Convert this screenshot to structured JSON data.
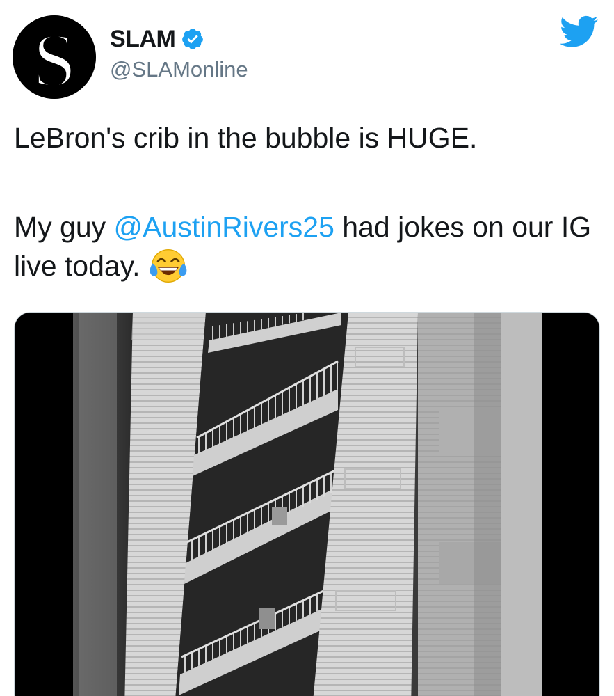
{
  "tweet": {
    "author": {
      "display_name": "SLAM",
      "handle": "@SLAMonline",
      "avatar_letter": "S",
      "verified": true
    },
    "text": {
      "line1": "LeBron's crib in the bubble is HUGE.",
      "line2_prefix": "My guy ",
      "mention": "@AustinRivers25",
      "line2_suffix": " had jokes on our IG live today.",
      "emoji": "face-with-tears-of-joy"
    },
    "media": {
      "type": "video"
    }
  },
  "colors": {
    "link": "#1da1f2",
    "verified": "#1da1f2",
    "handle": "#657786",
    "text": "#14171a"
  },
  "icons": [
    "verified-badge-icon",
    "twitter-bird-icon",
    "tears-of-joy-emoji-icon"
  ]
}
